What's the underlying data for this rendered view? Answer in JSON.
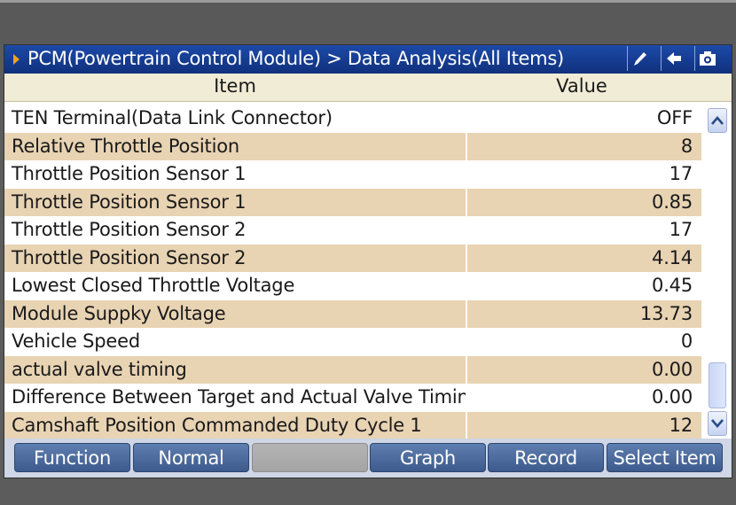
{
  "window": {
    "title": "PCM(Powertrain Control Module) > Data Analysis(All Items)",
    "toolbar_icons": [
      "edit-icon",
      "back-arrow-icon",
      "capture-icon"
    ]
  },
  "table": {
    "headers": {
      "item": "Item",
      "value": "Value"
    },
    "rows": [
      {
        "item": "TEN Terminal(Data Link Connector)",
        "value": "OFF"
      },
      {
        "item": "Relative Throttle Position",
        "value": "8"
      },
      {
        "item": "Throttle Position Sensor 1",
        "value": "17"
      },
      {
        "item": "Throttle Position Sensor 1",
        "value": "0.85"
      },
      {
        "item": "Throttle Position Sensor 2",
        "value": "17"
      },
      {
        "item": "Throttle Position Sensor 2",
        "value": "4.14"
      },
      {
        "item": "Lowest Closed Throttle Voltage",
        "value": "0.45"
      },
      {
        "item": "Module Suppky Voltage",
        "value": "13.73"
      },
      {
        "item": "Vehicle Speed",
        "value": "0"
      },
      {
        "item": "actual valve timing",
        "value": "0.00"
      },
      {
        "item": "Difference Between Target and Actual Valve Timing",
        "value": "0.00"
      },
      {
        "item": "Camshaft Position Commanded Duty Cycle 1",
        "value": "12"
      }
    ]
  },
  "buttons": {
    "function": "Function",
    "normal": "Normal",
    "empty": "",
    "graph": "Graph",
    "record": "Record",
    "select_item": "Select Item"
  },
  "colors": {
    "title_bar": "#1c4aa8",
    "row_alt": "#e8d3b3",
    "button": "#4d6b9e"
  }
}
